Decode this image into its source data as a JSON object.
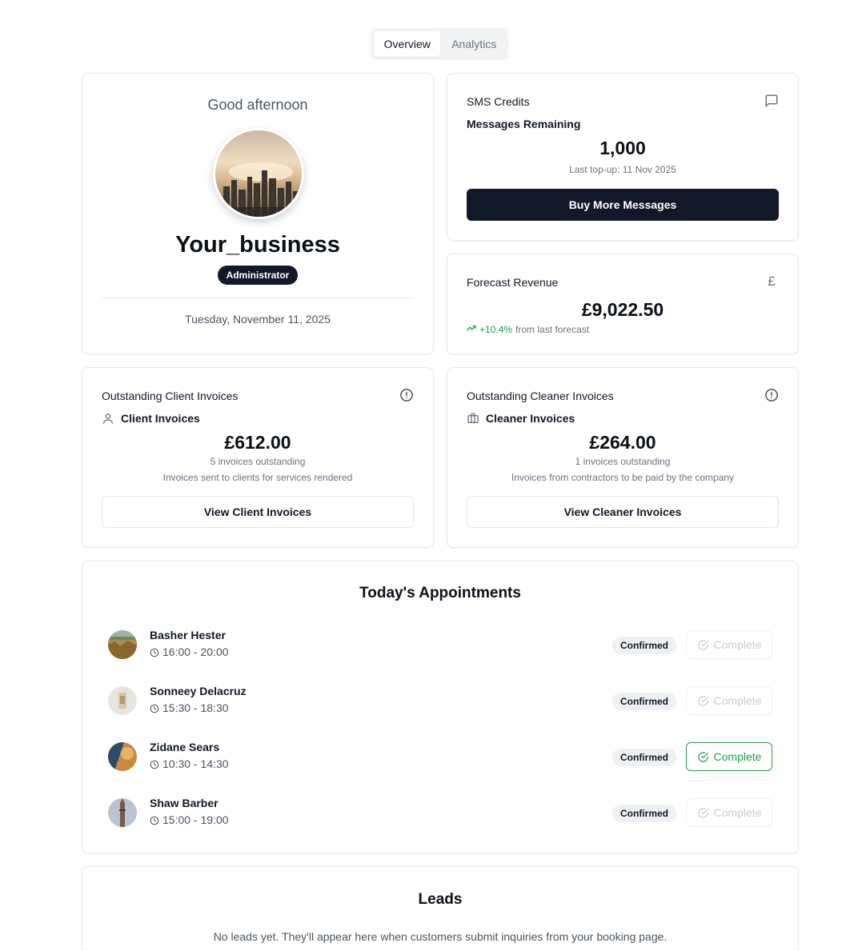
{
  "tabs": [
    {
      "label": "Overview",
      "active": true
    },
    {
      "label": "Analytics",
      "active": false
    }
  ],
  "profile": {
    "greeting": "Good afternoon",
    "business_name": "Your_business",
    "role": "Administrator",
    "date": "Tuesday, November 11, 2025"
  },
  "sms": {
    "title": "SMS Credits",
    "subtitle": "Messages Remaining",
    "value": "1,000",
    "last_topup": "Last top-up: 11 Nov 2025",
    "button": "Buy More Messages",
    "icon": "message-square-icon"
  },
  "forecast": {
    "title": "Forecast Revenue",
    "value": "£9,022.50",
    "trend_value": "+10.4%",
    "trend_text": "from last forecast",
    "icon": "pound-icon",
    "trend_color": "#22a04b"
  },
  "client_invoices": {
    "title": "Outstanding Client Invoices",
    "subtitle": "Client Invoices",
    "value": "£612.00",
    "count_text": "5 invoices outstanding",
    "description": "Invoices sent to clients for services rendered",
    "button": "View Client Invoices"
  },
  "cleaner_invoices": {
    "title": "Outstanding Cleaner Invoices",
    "subtitle": "Cleaner Invoices",
    "value": "£264.00",
    "count_text": "1 invoices outstanding",
    "description": "Invoices from contractors to be paid by the company",
    "button": "View Cleaner Invoices"
  },
  "appointments": {
    "title": "Today's Appointments",
    "items": [
      {
        "name": "Basher Hester",
        "time": "16:00 - 20:00",
        "status": "Confirmed",
        "action": "Complete",
        "action_enabled": false
      },
      {
        "name": "Sonneey Delacruz",
        "time": "15:30 - 18:30",
        "status": "Confirmed",
        "action": "Complete",
        "action_enabled": false
      },
      {
        "name": "Zidane Sears",
        "time": "10:30 - 14:30",
        "status": "Confirmed",
        "action": "Complete",
        "action_enabled": true
      },
      {
        "name": "Shaw Barber",
        "time": "15:00 - 19:00",
        "status": "Confirmed",
        "action": "Complete",
        "action_enabled": false
      }
    ]
  },
  "leads": {
    "title": "Leads",
    "empty_text": "No leads yet. They'll appear here when customers submit inquiries from your booking page."
  },
  "colors": {
    "primary_dark": "#111827",
    "success": "#22a04b",
    "muted": "#6b7280"
  }
}
